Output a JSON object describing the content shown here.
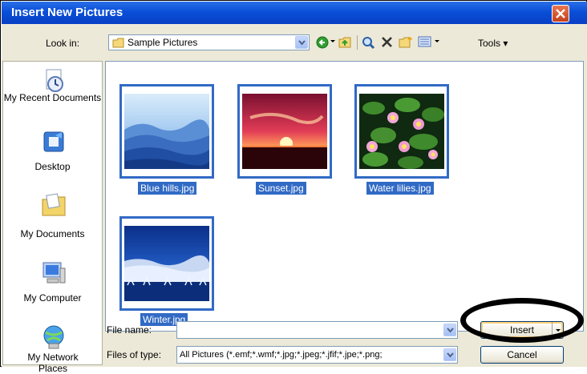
{
  "window": {
    "title": "Insert New Pictures",
    "close_icon": "close-icon"
  },
  "toolbar": {
    "look_in_label": "Look in:",
    "look_in_value": "Sample Pictures",
    "tools_label": "Tools"
  },
  "places": [
    {
      "label": "My Recent Documents",
      "icon": "recent-documents-icon"
    },
    {
      "label": "Desktop",
      "icon": "desktop-icon"
    },
    {
      "label": "My Documents",
      "icon": "my-documents-icon"
    },
    {
      "label": "My Computer",
      "icon": "my-computer-icon"
    },
    {
      "label": "My Network Places",
      "icon": "network-places-icon"
    }
  ],
  "files": [
    {
      "name": "Blue hills.jpg"
    },
    {
      "name": "Sunset.jpg"
    },
    {
      "name": "Water lilies.jpg"
    },
    {
      "name": "Winter.jpg"
    }
  ],
  "form": {
    "file_name_label": "File name:",
    "file_name_value": "",
    "file_type_label": "Files of type:",
    "file_type_value": "All Pictures (*.emf;*.wmf;*.jpg;*.jpeg;*.jfif;*.jpe;*.png;"
  },
  "buttons": {
    "insert": "Insert",
    "cancel": "Cancel"
  },
  "colors": {
    "titlebar": "#0a4fd8",
    "selection": "#316ac5",
    "dialog_bg": "#ece9d8"
  }
}
